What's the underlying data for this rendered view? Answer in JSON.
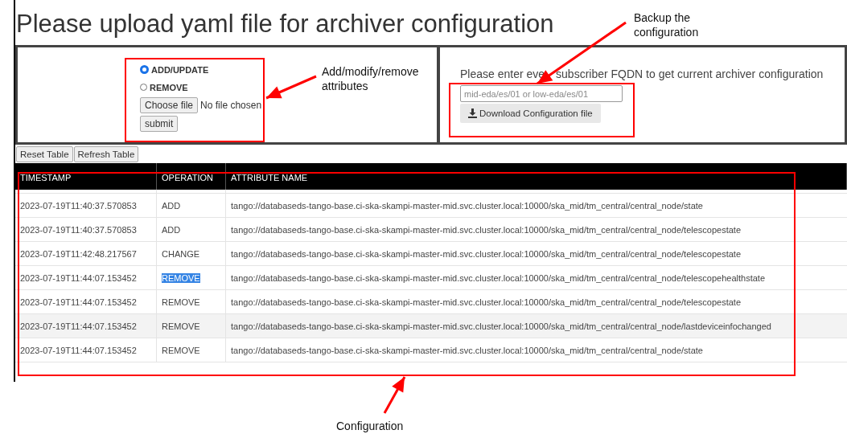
{
  "title": "Please upload yaml file for archiver configuration",
  "upload_panel": {
    "radios": [
      {
        "label": "ADD/UPDATE",
        "selected": true
      },
      {
        "label": "REMOVE",
        "selected": false
      }
    ],
    "file_button": "Choose file",
    "file_status": "No file chosen",
    "submit_button": "submit"
  },
  "download_panel": {
    "prompt_start": "Please enter eve",
    "prompt_end": "subscriber FQDN to get current archiver configuration",
    "input": {
      "placeholder": "mid-eda/es/01 or low-eda/es/01"
    },
    "download_button": "Download Configuration file"
  },
  "table_buttons": [
    "Reset Table",
    "Refresh Table"
  ],
  "table": {
    "columns": [
      "TIMESTAMP",
      "OPERATION",
      "ATTRIBUTE NAME"
    ],
    "rows": [
      {
        "timestamp": "2023-07-19T11:40:37.570853",
        "operation": "ADD",
        "operation_highlighted": false,
        "hovered": false,
        "attribute": "tango://databaseds-tango-base.ci-ska-skampi-master-mid.svc.cluster.local:10000/ska_mid/tm_central/central_node/state"
      },
      {
        "timestamp": "2023-07-19T11:40:37.570853",
        "operation": "ADD",
        "operation_highlighted": false,
        "hovered": false,
        "attribute": "tango://databaseds-tango-base.ci-ska-skampi-master-mid.svc.cluster.local:10000/ska_mid/tm_central/central_node/telescopestate"
      },
      {
        "timestamp": "2023-07-19T11:42:48.217567",
        "operation": "CHANGE",
        "operation_highlighted": false,
        "hovered": false,
        "attribute": "tango://databaseds-tango-base.ci-ska-skampi-master-mid.svc.cluster.local:10000/ska_mid/tm_central/central_node/telescopestate"
      },
      {
        "timestamp": "2023-07-19T11:44:07.153452",
        "operation": "REMOVE",
        "operation_highlighted": true,
        "hovered": false,
        "attribute": "tango://databaseds-tango-base.ci-ska-skampi-master-mid.svc.cluster.local:10000/ska_mid/tm_central/central_node/telescopehealthstate"
      },
      {
        "timestamp": "2023-07-19T11:44:07.153452",
        "operation": "REMOVE",
        "operation_highlighted": false,
        "hovered": false,
        "attribute": "tango://databaseds-tango-base.ci-ska-skampi-master-mid.svc.cluster.local:10000/ska_mid/tm_central/central_node/telescopestate"
      },
      {
        "timestamp": "2023-07-19T11:44:07.153452",
        "operation": "REMOVE",
        "operation_highlighted": false,
        "hovered": true,
        "attribute": "tango://databaseds-tango-base.ci-ska-skampi-master-mid.svc.cluster.local:10000/ska_mid/tm_central/central_node/lastdeviceinfochanged"
      },
      {
        "timestamp": "2023-07-19T11:44:07.153452",
        "operation": "REMOVE",
        "operation_highlighted": false,
        "hovered": false,
        "attribute": "tango://databaseds-tango-base.ci-ska-skampi-master-mid.svc.cluster.local:10000/ska_mid/tm_central/central_node/state"
      }
    ]
  },
  "annotations": [
    {
      "label": "Add/modify/remove attributes"
    },
    {
      "label": "Backup the configuration"
    },
    {
      "label": "Configuration"
    }
  ]
}
